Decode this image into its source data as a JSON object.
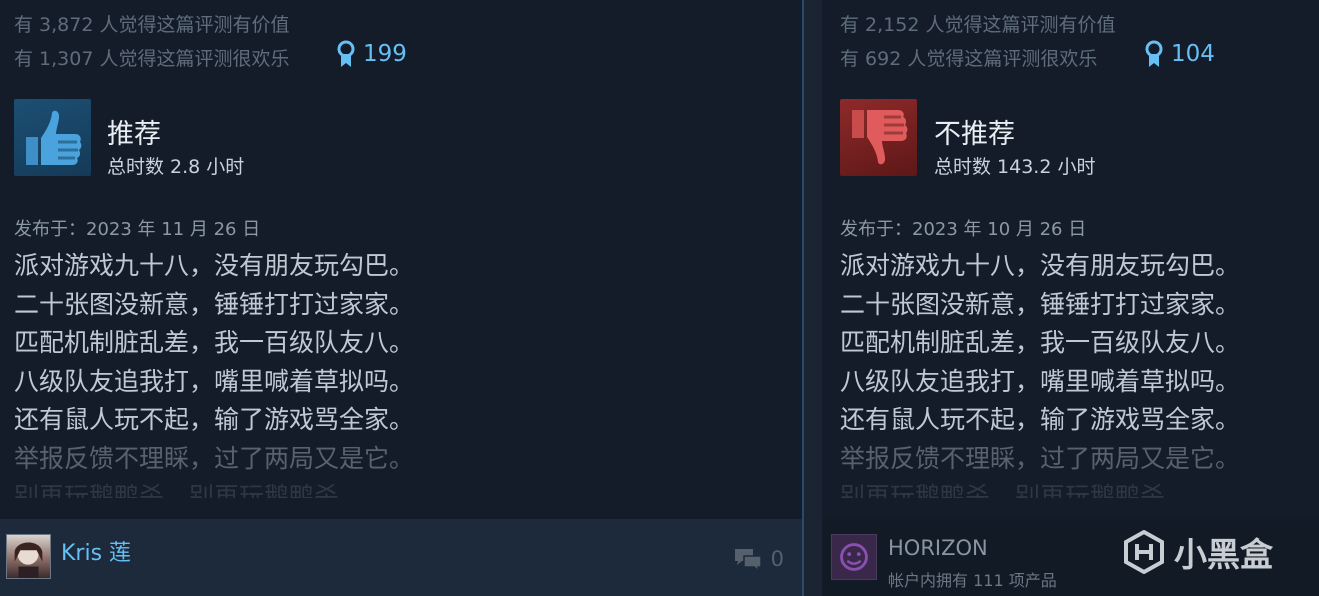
{
  "left": {
    "helpful_text": "有 3,872 人觉得这篇评测有价值",
    "funny_text": "有 1,307 人觉得这篇评测很欢乐",
    "award_count": "199",
    "verdict": "推荐",
    "hours": "总时数 2.8 小时",
    "posted": "发布于：2023 年 11 月 26 日",
    "body_lines": [
      "派对游戏九十八，没有朋友玩勾巴。",
      "二十张图没新意，锤锤打打过家家。",
      "匹配机制脏乱差，我一百级队友八。",
      "八级队友追我打，嘴里喊着草拟吗。",
      "还有鼠人玩不起，输了游戏骂全家。",
      "举报反馈不理睬，过了两局又是它。",
      "别再玩鹅鸭杀，别再玩鹅鸭杀。"
    ],
    "username": "Kris 莲",
    "comment_count": "0"
  },
  "right": {
    "helpful_text": "有 2,152 人觉得这篇评测有价值",
    "funny_text": "有 692 人觉得这篇评测很欢乐",
    "award_count": "104",
    "verdict": "不推荐",
    "hours": "总时数 143.2 小时",
    "posted": "发布于：2023 年 10 月 26 日",
    "body_lines": [
      "派对游戏九十八，没有朋友玩勾巴。",
      "二十张图没新意，锤锤打打过家家。",
      "匹配机制脏乱差，我一百级队友八。",
      "八级队友追我打，嘴里喊着草拟吗。",
      "还有鼠人玩不起，输了游戏骂全家。",
      "举报反馈不理睬，过了两局又是它。",
      "别再玩鹅鸭杀，别再玩鹅鸭杀。"
    ],
    "username": "HORIZON",
    "products": "帐户内拥有 111 项产品"
  },
  "watermark": {
    "text": "小黑盒"
  },
  "colors": {
    "accent": "#66c0f4",
    "thumb_up": "#1c4f74",
    "thumb_down": "#8e2a2a",
    "background": "#131c28"
  },
  "icons": {
    "award": "award-ribbon-icon",
    "thumb_up": "thumbs-up-icon",
    "thumb_down": "thumbs-down-icon",
    "comment": "comment-bubbles-icon",
    "watermark_logo": "xiaoheihe-logo-icon"
  }
}
